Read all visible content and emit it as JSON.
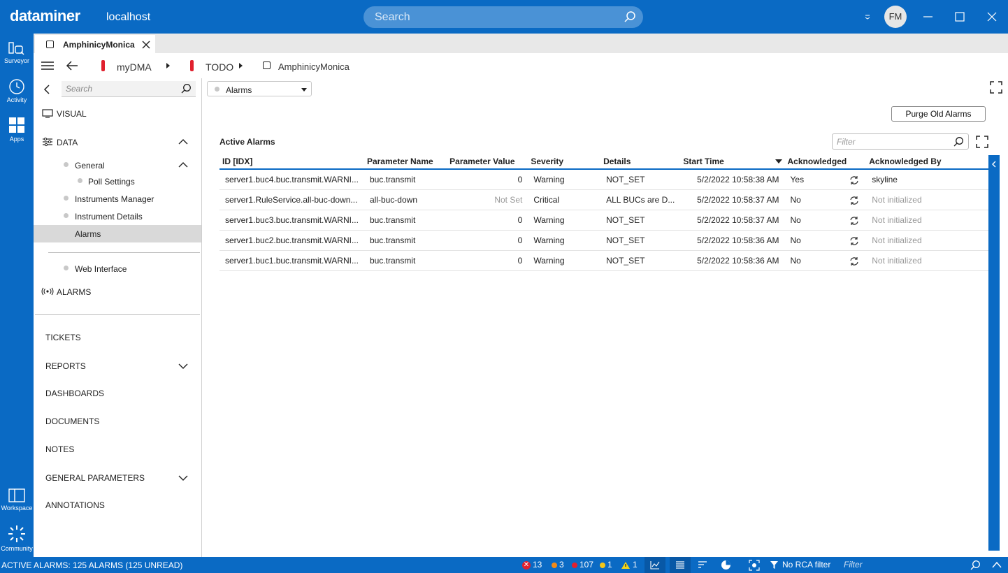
{
  "titlebar": {
    "brand": "dataminer",
    "host": "localhost",
    "search_placeholder": "Search",
    "avatar_initials": "FM"
  },
  "rail": {
    "items": [
      {
        "label": "Surveyor",
        "icon": "surveyor-icon"
      },
      {
        "label": "Activity",
        "icon": "activity-icon"
      },
      {
        "label": "Apps",
        "icon": "apps-icon"
      },
      {
        "label": "Workspace",
        "icon": "workspace-icon"
      },
      {
        "label": "Community",
        "icon": "community-icon"
      }
    ]
  },
  "tab": {
    "label": "AmphinicyMonica"
  },
  "breadcrumb": {
    "items": [
      "myDMA",
      "TODO",
      "AmphinicyMonica"
    ]
  },
  "nav": {
    "search_placeholder": "Search",
    "visual": "VISUAL",
    "data": "DATA",
    "general": "General",
    "poll_settings": "Poll Settings",
    "instruments_manager": "Instruments Manager",
    "instrument_details": "Instrument Details",
    "alarms": "Alarms",
    "web_interface": "Web Interface",
    "alarms_section": "ALARMS",
    "tickets": "TICKETS",
    "reports": "REPORTS",
    "dashboards": "DASHBOARDS",
    "documents": "DOCUMENTS",
    "notes": "NOTES",
    "general_parameters": "GENERAL PARAMETERS",
    "annotations": "ANNOTATIONS"
  },
  "main": {
    "view_select": "Alarms",
    "purge_button": "Purge Old Alarms",
    "section_title": "Active Alarms",
    "filter_placeholder": "Filter",
    "columns": [
      "ID [IDX]",
      "Parameter Name",
      "Parameter Value",
      "Severity",
      "Details",
      "Start Time",
      "Acknowledged",
      "Acknowledged By"
    ],
    "rows": [
      {
        "id": "server1.buc4.buc.transmit.WARNI...",
        "param": "buc.transmit",
        "value": "0",
        "severity": "Warning",
        "details": "NOT_SET",
        "start": "5/2/2022 10:58:38 AM",
        "ack": "Yes",
        "ack_by": "skyline"
      },
      {
        "id": "server1.RuleService.all-buc-down...",
        "param": "all-buc-down",
        "value": "Not Set",
        "severity": "Critical",
        "details": "ALL BUCs are D...",
        "start": "5/2/2022 10:58:37 AM",
        "ack": "No",
        "ack_by": "Not initialized"
      },
      {
        "id": "server1.buc3.buc.transmit.WARNI...",
        "param": "buc.transmit",
        "value": "0",
        "severity": "Warning",
        "details": "NOT_SET",
        "start": "5/2/2022 10:58:37 AM",
        "ack": "No",
        "ack_by": "Not initialized"
      },
      {
        "id": "server1.buc2.buc.transmit.WARNI...",
        "param": "buc.transmit",
        "value": "0",
        "severity": "Warning",
        "details": "NOT_SET",
        "start": "5/2/2022 10:58:36 AM",
        "ack": "No",
        "ack_by": "Not initialized"
      },
      {
        "id": "server1.buc1.buc.transmit.WARNI...",
        "param": "buc.transmit",
        "value": "0",
        "severity": "Warning",
        "details": "NOT_SET",
        "start": "5/2/2022 10:58:36 AM",
        "ack": "No",
        "ack_by": "Not initialized"
      }
    ]
  },
  "status": {
    "text": "ACTIVE ALARMS: 125 ALARMS (125 UNREAD)",
    "critical_count": "13",
    "major_count": "3",
    "minor_count": "107",
    "warning_count": "1",
    "notice_count": "1",
    "rca": "No RCA filter",
    "filter_placeholder": "Filter",
    "colors": {
      "critical": "#e0202e",
      "major": "#f28a18",
      "minor": "#f2c618",
      "warning": "#f2d418"
    }
  }
}
